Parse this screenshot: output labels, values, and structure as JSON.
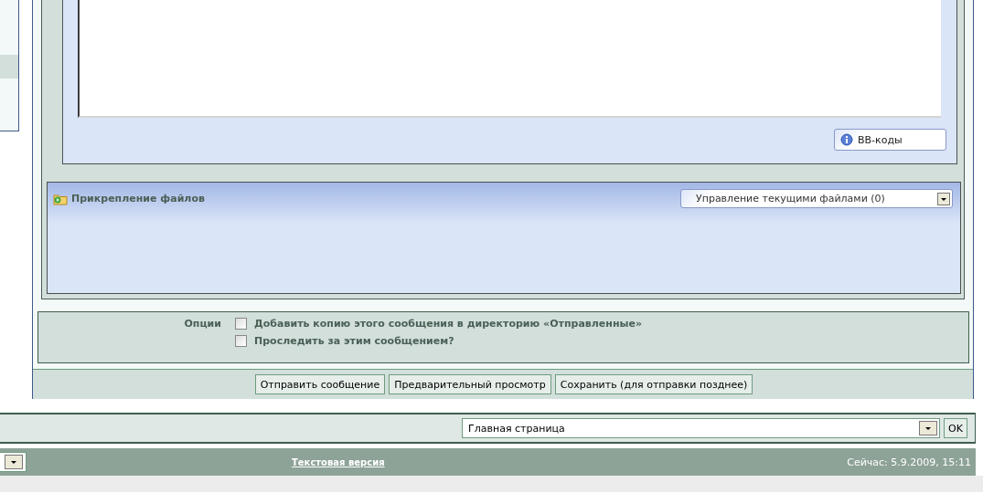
{
  "editor": {
    "bb_codes_button": "BB-коды"
  },
  "attachments": {
    "title": "Прикрепление файлов",
    "manage_select": "Управление текущими файлами (0)"
  },
  "options": {
    "label": "Опции",
    "items": [
      {
        "label": "Добавить копию этого сообщения в директорию «Отправленные»",
        "checked": false
      },
      {
        "label": "Проследить за этим сообщением?",
        "checked": false
      }
    ]
  },
  "buttons": [
    "Отправить сообщение",
    "Предварительный просмотр",
    "Сохранить (для отправки позднее)"
  ],
  "jump": {
    "value": "Главная страница",
    "ok": "OK"
  },
  "footer": {
    "text_version_link": "Текстовая версия",
    "time": "Сейчас: 5.9.2009, 15:11"
  }
}
